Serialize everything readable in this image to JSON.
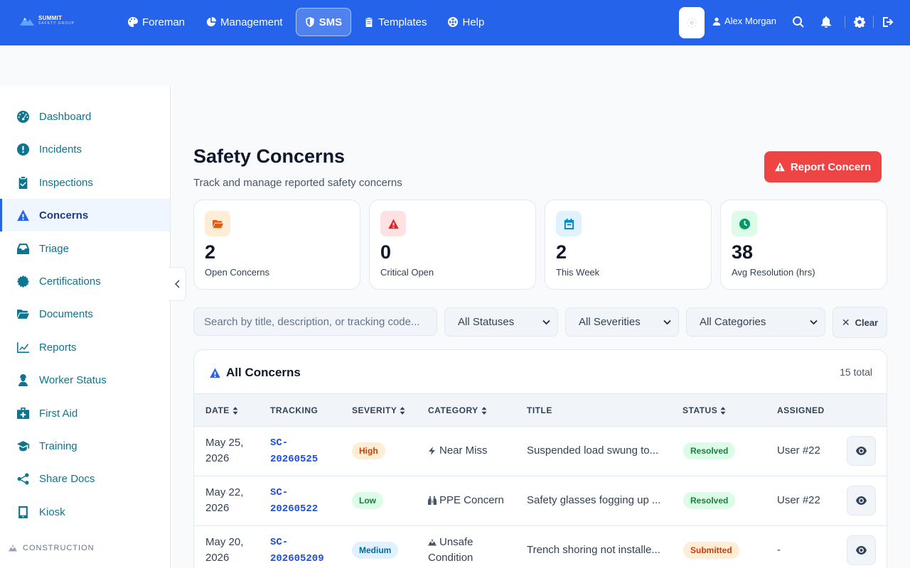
{
  "brand": {
    "name": "SUMMIT",
    "tagline": "SAFETY GROUP"
  },
  "nav": {
    "items": [
      {
        "label": "Foreman",
        "icon": "palette-icon"
      },
      {
        "label": "Management",
        "icon": "pie-chart-icon"
      },
      {
        "label": "SMS",
        "icon": "shield-icon",
        "active": true
      },
      {
        "label": "Templates",
        "icon": "clipboard-icon"
      },
      {
        "label": "Help",
        "icon": "lifebuoy-icon"
      }
    ]
  },
  "user": {
    "name": "Alex Morgan"
  },
  "sidebar": {
    "items": [
      {
        "label": "Dashboard",
        "icon": "gauge-icon"
      },
      {
        "label": "Incidents",
        "icon": "alert-circle-icon"
      },
      {
        "label": "Inspections",
        "icon": "clipboard-check-icon"
      },
      {
        "label": "Concerns",
        "icon": "warning-triangle-icon",
        "active": true
      },
      {
        "label": "Triage",
        "icon": "inbox-icon"
      },
      {
        "label": "Certifications",
        "icon": "certificate-icon"
      },
      {
        "label": "Documents",
        "icon": "folder-open-icon"
      },
      {
        "label": "Reports",
        "icon": "line-chart-icon"
      },
      {
        "label": "Worker Status",
        "icon": "worker-icon"
      },
      {
        "label": "First Aid",
        "icon": "medkit-icon"
      },
      {
        "label": "Training",
        "icon": "graduation-cap-icon"
      },
      {
        "label": "Share Docs",
        "icon": "share-icon"
      },
      {
        "label": "Kiosk",
        "icon": "tablet-icon"
      }
    ],
    "section_label": "CONSTRUCTION"
  },
  "page": {
    "title": "Safety Concerns",
    "subtitle": "Track and manage reported safety concerns",
    "report_button": "Report Concern"
  },
  "stats": [
    {
      "value": "2",
      "label": "Open Concerns",
      "icon": "folder-open-icon",
      "bg": "#ffedd5",
      "fg": "#ea580c"
    },
    {
      "value": "0",
      "label": "Critical Open",
      "icon": "warning-triangle-icon",
      "bg": "#fee2e2",
      "fg": "#dc2626"
    },
    {
      "value": "2",
      "label": "This Week",
      "icon": "calendar-icon",
      "bg": "#e0f2fe",
      "fg": "#0284c7"
    },
    {
      "value": "38",
      "label": "Avg Resolution (hrs)",
      "icon": "clock-icon",
      "bg": "#dcfce7",
      "fg": "#059669"
    }
  ],
  "filters": {
    "search_placeholder": "Search by title, description, or tracking code...",
    "status": "All Statuses",
    "severity": "All Severities",
    "category": "All Categories",
    "clear": "Clear"
  },
  "table": {
    "title": "All Concerns",
    "total": "15 total",
    "columns": [
      "DATE",
      "TRACKING",
      "SEVERITY",
      "CATEGORY",
      "TITLE",
      "STATUS",
      "ASSIGNED"
    ],
    "rows": [
      {
        "date": [
          "May 25,",
          "2026"
        ],
        "tracking": [
          "SC-",
          "20260525"
        ],
        "severity": "High",
        "category": [
          "Near Miss"
        ],
        "category_icon": "bolt-icon",
        "title": "Suspended load swung to...",
        "status": "Resolved",
        "assigned": "User #22"
      },
      {
        "date": [
          "May 22,",
          "2026"
        ],
        "tracking": [
          "SC-",
          "20260522"
        ],
        "severity": "Low",
        "category": [
          "PPE Concern"
        ],
        "category_icon": "binoculars-icon",
        "title": "Safety glasses fogging up ...",
        "status": "Resolved",
        "assigned": "User #22"
      },
      {
        "date": [
          "May 20,",
          "2026"
        ],
        "tracking": [
          "SC-",
          "202605209"
        ],
        "severity": "Medium",
        "category": [
          "Unsafe",
          "Condition"
        ],
        "category_icon": "hard-hat-icon",
        "title": "Trench shoring not installe...",
        "status": "Submitted",
        "assigned": "-"
      }
    ]
  },
  "colors": {
    "primary": "#2563eb",
    "danger": "#ef4444",
    "sidebar_text": "#0e7490",
    "severity": {
      "High": {
        "bg": "#ffedd5",
        "fg": "#c2410c"
      },
      "Low": {
        "bg": "#dcfce7",
        "fg": "#15803d"
      },
      "Medium": {
        "bg": "#e0f2fe",
        "fg": "#0369a1"
      }
    },
    "status": {
      "Resolved": {
        "bg": "#dcfce7",
        "fg": "#15803d"
      },
      "Submitted": {
        "bg": "#ffedd5",
        "fg": "#c2410c"
      }
    }
  }
}
